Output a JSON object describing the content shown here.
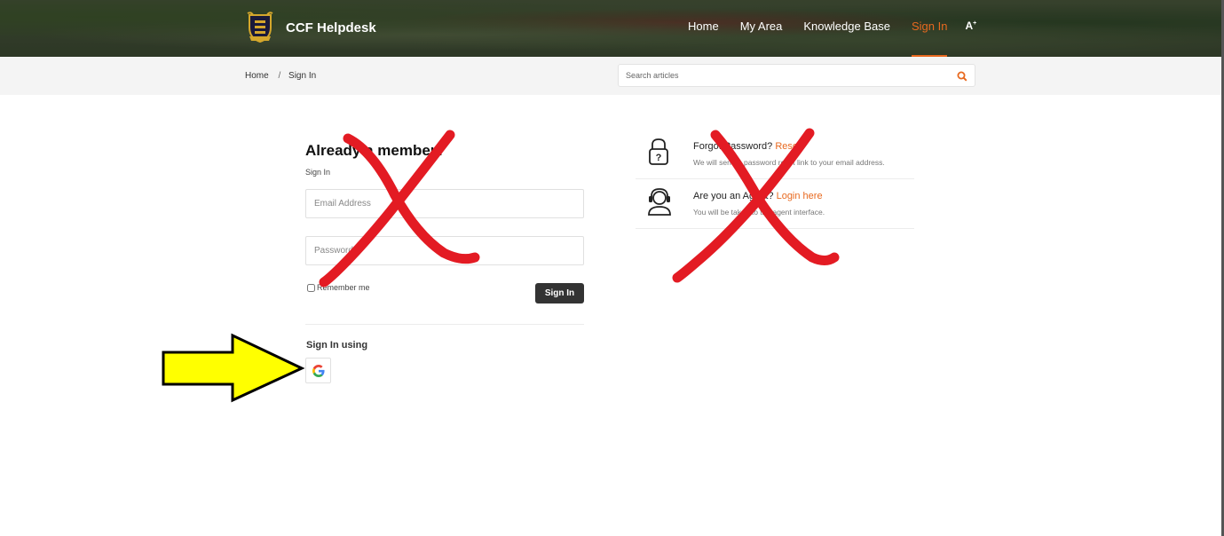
{
  "header": {
    "brand": "CCF Helpdesk",
    "nav": [
      {
        "label": "Home",
        "active": false
      },
      {
        "label": "My Area",
        "active": false
      },
      {
        "label": "Knowledge Base",
        "active": false
      },
      {
        "label": "Sign In",
        "active": true
      }
    ],
    "a11y_label": "A",
    "accent": "#e8691f"
  },
  "breadcrumb": {
    "home": "Home",
    "separator": "/",
    "current": "Sign In"
  },
  "search": {
    "placeholder": "Search articles",
    "icon": "search-icon"
  },
  "signin": {
    "title": "Already a member?",
    "subtitle": "Sign In",
    "email_placeholder": "Email Address",
    "password_placeholder": "Password",
    "remember_label": "Remember me",
    "button_label": "Sign In",
    "using_label": "Sign In using",
    "provider_icon": "google-icon"
  },
  "helpers": [
    {
      "icon": "lock-question-icon",
      "title": "Forgot Password?",
      "link": "Reset",
      "desc": "We will send a password reset link to your email address."
    },
    {
      "icon": "agent-headset-icon",
      "title": "Are you an Agent?",
      "link": "Login here",
      "desc": "You will be taken to the agent interface."
    }
  ],
  "annotations": {
    "cross_color": "#e31b23",
    "arrow_color": "#ffff00"
  }
}
